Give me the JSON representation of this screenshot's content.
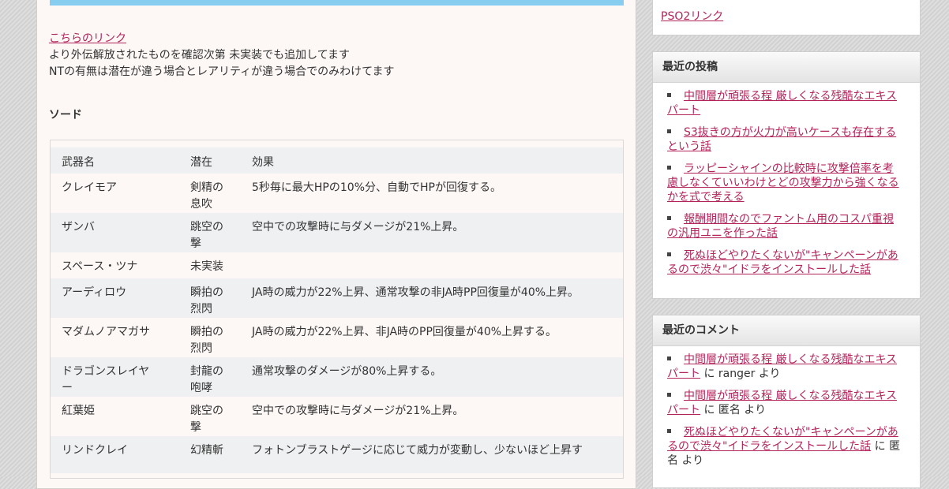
{
  "intro": {
    "link": "こちらのリンク",
    "line1": "より外伝解放されたものを確認次第 未実装でも追加してます",
    "line2": "NTの有無は潜在が違う場合とレアリティが違う場合でのみわけてます"
  },
  "section_heading": "ソード",
  "table": {
    "headers": [
      "武器名",
      "潜在",
      "効果"
    ],
    "rows": [
      {
        "name": "クレイモア",
        "potential": [
          "剣精の",
          "息吹"
        ],
        "effect": "5秒毎に最大HPの10%分、自動でHPが回復する。"
      },
      {
        "name": "ザンバ",
        "potential": [
          "跳空の",
          "撃"
        ],
        "effect": "空中での攻撃時に与ダメージが21%上昇。"
      },
      {
        "name": "スペース・ツナ",
        "potential": [
          "未実装"
        ],
        "effect": ""
      },
      {
        "name": "アーディロウ",
        "potential": [
          "瞬拍の",
          "烈閃"
        ],
        "effect": "JA時の威力が22%上昇、通常攻撃の非JA時PP回復量が40%上昇。"
      },
      {
        "name": "マダムノアマガサ",
        "potential": [
          "瞬拍の",
          "烈閃"
        ],
        "effect": "JA時の威力が22%上昇、非JA時のPP回復量が40%上昇する。"
      },
      {
        "name": [
          "ドラゴンスレイヤ",
          "ー"
        ],
        "potential": [
          "封龍の",
          "咆哮"
        ],
        "effect": "通常攻撃のダメージが80%上昇する。"
      },
      {
        "name": "紅葉姫",
        "potential": [
          "跳空の",
          "撃"
        ],
        "effect": "空中での攻撃時に与ダメージが21%上昇。"
      },
      {
        "name": "リンドクレイ",
        "potential": [
          "幻精斬"
        ],
        "effect": "フォトンブラストゲージに応じて威力が変動し、少ないほど上昇す"
      }
    ]
  },
  "sidebar": {
    "top_link": "PSO2リンク",
    "recent_posts": {
      "title": "最近の投稿",
      "items": [
        "中間層が頑張る程 厳しくなる残酷なエキスパート",
        "S3抜きの方が火力が高いケースも存在するという話",
        "ラッピーシャインの比較時に攻撃倍率を考慮しなくていいわけとどの攻撃力から強くなるかを式で考える",
        "報酬期間なのでファントム用のコスパ重視の汎用ユニを作った話",
        "死ぬほどやりたくないが\"キャンペーンがあるので渋々\"イドラをインストールした話"
      ]
    },
    "recent_comments": {
      "title": "最近のコメント",
      "items": [
        {
          "post": "中間層が頑張る程 厳しくなる残酷なエキスパート",
          "suffix": " に ranger より"
        },
        {
          "post": "中間層が頑張る程 厳しくなる残酷なエキスパート",
          "suffix": " に 匿名 より"
        },
        {
          "post": "死ぬほどやりたくないが\"キャンペーンがあるので渋々\"イドラをインストールした話",
          "suffix": " に 匿名 より"
        }
      ]
    }
  }
}
